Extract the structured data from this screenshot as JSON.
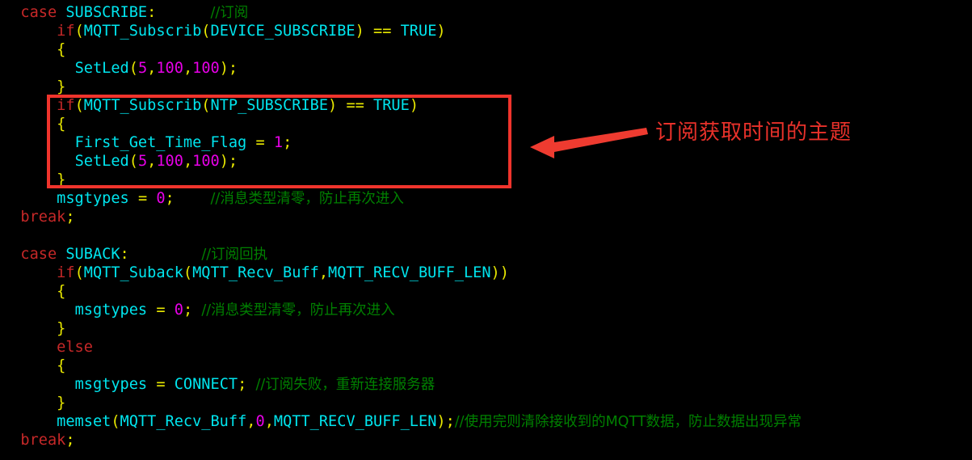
{
  "editor": {
    "background": "#000000",
    "colors": {
      "keyword": "#c62828",
      "identifier": "#00e5ee",
      "punctuation": "#e8e800",
      "number": "#e800e8",
      "comment": "#008000",
      "annotation": "#e8312a",
      "highlight_box": "#f0342c"
    },
    "lines": [
      {
        "index": 0,
        "tokens": [
          {
            "t": "  ",
            "c": "plain"
          },
          {
            "t": "case",
            "c": "kw"
          },
          {
            "t": " SUBSCRIBE",
            "c": "id"
          },
          {
            "t": ":",
            "c": "punct"
          },
          {
            "t": "      ",
            "c": "plain"
          },
          {
            "t": "//订阅",
            "c": "cmt"
          }
        ]
      },
      {
        "index": 1,
        "tokens": [
          {
            "t": "      ",
            "c": "plain"
          },
          {
            "t": "if",
            "c": "kw"
          },
          {
            "t": "(",
            "c": "punct"
          },
          {
            "t": "MQTT_Subscrib",
            "c": "id"
          },
          {
            "t": "(",
            "c": "punct"
          },
          {
            "t": "DEVICE_SUBSCRIBE",
            "c": "id"
          },
          {
            "t": ")",
            "c": "punct"
          },
          {
            "t": " ",
            "c": "plain"
          },
          {
            "t": "==",
            "c": "punct"
          },
          {
            "t": " TRUE",
            "c": "id"
          },
          {
            "t": ")",
            "c": "punct"
          }
        ]
      },
      {
        "index": 2,
        "tokens": [
          {
            "t": "      ",
            "c": "plain"
          },
          {
            "t": "{",
            "c": "punct"
          }
        ]
      },
      {
        "index": 3,
        "tokens": [
          {
            "t": "        ",
            "c": "plain"
          },
          {
            "t": "SetLed",
            "c": "id"
          },
          {
            "t": "(",
            "c": "punct"
          },
          {
            "t": "5",
            "c": "num"
          },
          {
            "t": ",",
            "c": "punct"
          },
          {
            "t": "100",
            "c": "num"
          },
          {
            "t": ",",
            "c": "punct"
          },
          {
            "t": "100",
            "c": "num"
          },
          {
            "t": ");",
            "c": "punct"
          }
        ]
      },
      {
        "index": 4,
        "tokens": [
          {
            "t": "      ",
            "c": "plain"
          },
          {
            "t": "}",
            "c": "punct"
          }
        ]
      },
      {
        "index": 5,
        "tokens": [
          {
            "t": "      ",
            "c": "plain"
          },
          {
            "t": "if",
            "c": "kw"
          },
          {
            "t": "(",
            "c": "punct"
          },
          {
            "t": "MQTT_Subscrib",
            "c": "id"
          },
          {
            "t": "(",
            "c": "punct"
          },
          {
            "t": "NTP_SUBSCRIBE",
            "c": "id"
          },
          {
            "t": ")",
            "c": "punct"
          },
          {
            "t": " ",
            "c": "plain"
          },
          {
            "t": "==",
            "c": "punct"
          },
          {
            "t": " TRUE",
            "c": "id"
          },
          {
            "t": ")",
            "c": "punct"
          }
        ]
      },
      {
        "index": 6,
        "tokens": [
          {
            "t": "      ",
            "c": "plain"
          },
          {
            "t": "{",
            "c": "punct"
          }
        ]
      },
      {
        "index": 7,
        "tokens": [
          {
            "t": "        ",
            "c": "plain"
          },
          {
            "t": "First_Get_Time_Flag",
            "c": "id"
          },
          {
            "t": " ",
            "c": "plain"
          },
          {
            "t": "=",
            "c": "punct"
          },
          {
            "t": " ",
            "c": "plain"
          },
          {
            "t": "1",
            "c": "num"
          },
          {
            "t": ";",
            "c": "punct"
          }
        ]
      },
      {
        "index": 8,
        "tokens": [
          {
            "t": "        ",
            "c": "plain"
          },
          {
            "t": "SetLed",
            "c": "id"
          },
          {
            "t": "(",
            "c": "punct"
          },
          {
            "t": "5",
            "c": "num"
          },
          {
            "t": ",",
            "c": "punct"
          },
          {
            "t": "100",
            "c": "num"
          },
          {
            "t": ",",
            "c": "punct"
          },
          {
            "t": "100",
            "c": "num"
          },
          {
            "t": ");",
            "c": "punct"
          }
        ]
      },
      {
        "index": 9,
        "tokens": [
          {
            "t": "      ",
            "c": "plain"
          },
          {
            "t": "}",
            "c": "punct"
          }
        ]
      },
      {
        "index": 10,
        "tokens": [
          {
            "t": "      ",
            "c": "plain"
          },
          {
            "t": "msgtypes",
            "c": "id"
          },
          {
            "t": " ",
            "c": "plain"
          },
          {
            "t": "=",
            "c": "punct"
          },
          {
            "t": " ",
            "c": "plain"
          },
          {
            "t": "0",
            "c": "num"
          },
          {
            "t": ";",
            "c": "punct"
          },
          {
            "t": "    ",
            "c": "plain"
          },
          {
            "t": "//消息类型清零，防止再次进入",
            "c": "cmt"
          }
        ]
      },
      {
        "index": 11,
        "tokens": [
          {
            "t": "  ",
            "c": "plain"
          },
          {
            "t": "break",
            "c": "kw"
          },
          {
            "t": ";",
            "c": "punct"
          }
        ]
      },
      {
        "index": 12,
        "tokens": []
      },
      {
        "index": 13,
        "tokens": [
          {
            "t": "  ",
            "c": "plain"
          },
          {
            "t": "case",
            "c": "kw"
          },
          {
            "t": " SUBACK",
            "c": "id"
          },
          {
            "t": ":",
            "c": "punct"
          },
          {
            "t": "        ",
            "c": "plain"
          },
          {
            "t": "//订阅回执",
            "c": "cmt"
          }
        ]
      },
      {
        "index": 14,
        "tokens": [
          {
            "t": "      ",
            "c": "plain"
          },
          {
            "t": "if",
            "c": "kw"
          },
          {
            "t": "(",
            "c": "punct"
          },
          {
            "t": "MQTT_Suback",
            "c": "id"
          },
          {
            "t": "(",
            "c": "punct"
          },
          {
            "t": "MQTT_Recv_Buff",
            "c": "id"
          },
          {
            "t": ",",
            "c": "punct"
          },
          {
            "t": "MQTT_RECV_BUFF_LEN",
            "c": "id"
          },
          {
            "t": "))",
            "c": "punct"
          }
        ]
      },
      {
        "index": 15,
        "tokens": [
          {
            "t": "      ",
            "c": "plain"
          },
          {
            "t": "{",
            "c": "punct"
          }
        ]
      },
      {
        "index": 16,
        "tokens": [
          {
            "t": "        ",
            "c": "plain"
          },
          {
            "t": "msgtypes",
            "c": "id"
          },
          {
            "t": " ",
            "c": "plain"
          },
          {
            "t": "=",
            "c": "punct"
          },
          {
            "t": " ",
            "c": "plain"
          },
          {
            "t": "0",
            "c": "num"
          },
          {
            "t": ";",
            "c": "punct"
          },
          {
            "t": " ",
            "c": "plain"
          },
          {
            "t": "//消息类型清零，防止再次进入",
            "c": "cmt"
          }
        ]
      },
      {
        "index": 17,
        "tokens": [
          {
            "t": "      ",
            "c": "plain"
          },
          {
            "t": "}",
            "c": "punct"
          }
        ]
      },
      {
        "index": 18,
        "tokens": [
          {
            "t": "      ",
            "c": "plain"
          },
          {
            "t": "else",
            "c": "kw"
          }
        ]
      },
      {
        "index": 19,
        "tokens": [
          {
            "t": "      ",
            "c": "plain"
          },
          {
            "t": "{",
            "c": "punct"
          }
        ]
      },
      {
        "index": 20,
        "tokens": [
          {
            "t": "        ",
            "c": "plain"
          },
          {
            "t": "msgtypes",
            "c": "id"
          },
          {
            "t": " ",
            "c": "plain"
          },
          {
            "t": "=",
            "c": "punct"
          },
          {
            "t": " CONNECT",
            "c": "id"
          },
          {
            "t": ";",
            "c": "punct"
          },
          {
            "t": " ",
            "c": "plain"
          },
          {
            "t": "//订阅失败，重新连接服务器",
            "c": "cmt"
          }
        ]
      },
      {
        "index": 21,
        "tokens": [
          {
            "t": "      ",
            "c": "plain"
          },
          {
            "t": "}",
            "c": "punct"
          }
        ]
      },
      {
        "index": 22,
        "tokens": [
          {
            "t": "      ",
            "c": "plain"
          },
          {
            "t": "memset",
            "c": "id"
          },
          {
            "t": "(",
            "c": "punct"
          },
          {
            "t": "MQTT_Recv_Buff",
            "c": "id"
          },
          {
            "t": ",",
            "c": "punct"
          },
          {
            "t": "0",
            "c": "num"
          },
          {
            "t": ",",
            "c": "punct"
          },
          {
            "t": "MQTT_RECV_BUFF_LEN",
            "c": "id"
          },
          {
            "t": ");",
            "c": "punct"
          },
          {
            "t": "//使用完则清除接收到的MQTT数据，防止数据出现异常",
            "c": "cmt"
          }
        ]
      },
      {
        "index": 23,
        "tokens": [
          {
            "t": "  ",
            "c": "plain"
          },
          {
            "t": "break",
            "c": "kw"
          },
          {
            "t": ";",
            "c": "punct"
          }
        ]
      }
    ]
  },
  "annotation": {
    "text": "订阅获取时间的主题",
    "arrow_direction": "left"
  }
}
